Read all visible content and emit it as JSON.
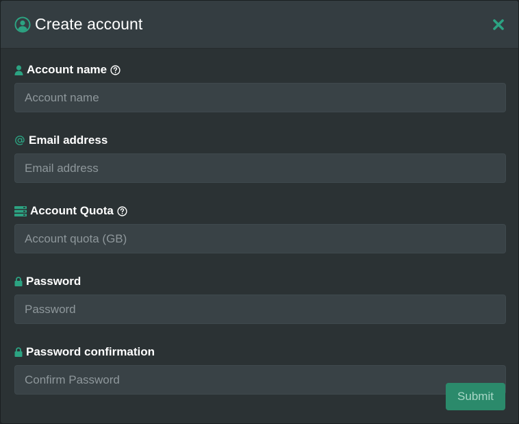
{
  "header": {
    "title": "Create account"
  },
  "fields": {
    "account_name": {
      "label": "Account name",
      "placeholder": "Account name",
      "value": ""
    },
    "email": {
      "label": "Email address",
      "placeholder": "Email address",
      "value": ""
    },
    "quota": {
      "label": "Account Quota",
      "placeholder": "Account quota (GB)",
      "value": ""
    },
    "password": {
      "label": "Password",
      "placeholder": "Password",
      "value": ""
    },
    "password_confirm": {
      "label": "Password confirmation",
      "placeholder": "Confirm Password",
      "value": ""
    }
  },
  "footer": {
    "submit_label": "Submit"
  },
  "icons": {
    "title": "user-circle-icon",
    "close": "close-icon",
    "account_name": "user-icon",
    "email": "at-icon",
    "quota": "storage-icon",
    "password": "lock-icon",
    "help": "question-circle-icon"
  },
  "colors": {
    "accent": "#2ca382",
    "modal_bg": "#2b3234",
    "header_bg": "#343d41",
    "input_bg": "#394246",
    "submit_bg": "#2b8a6b"
  }
}
